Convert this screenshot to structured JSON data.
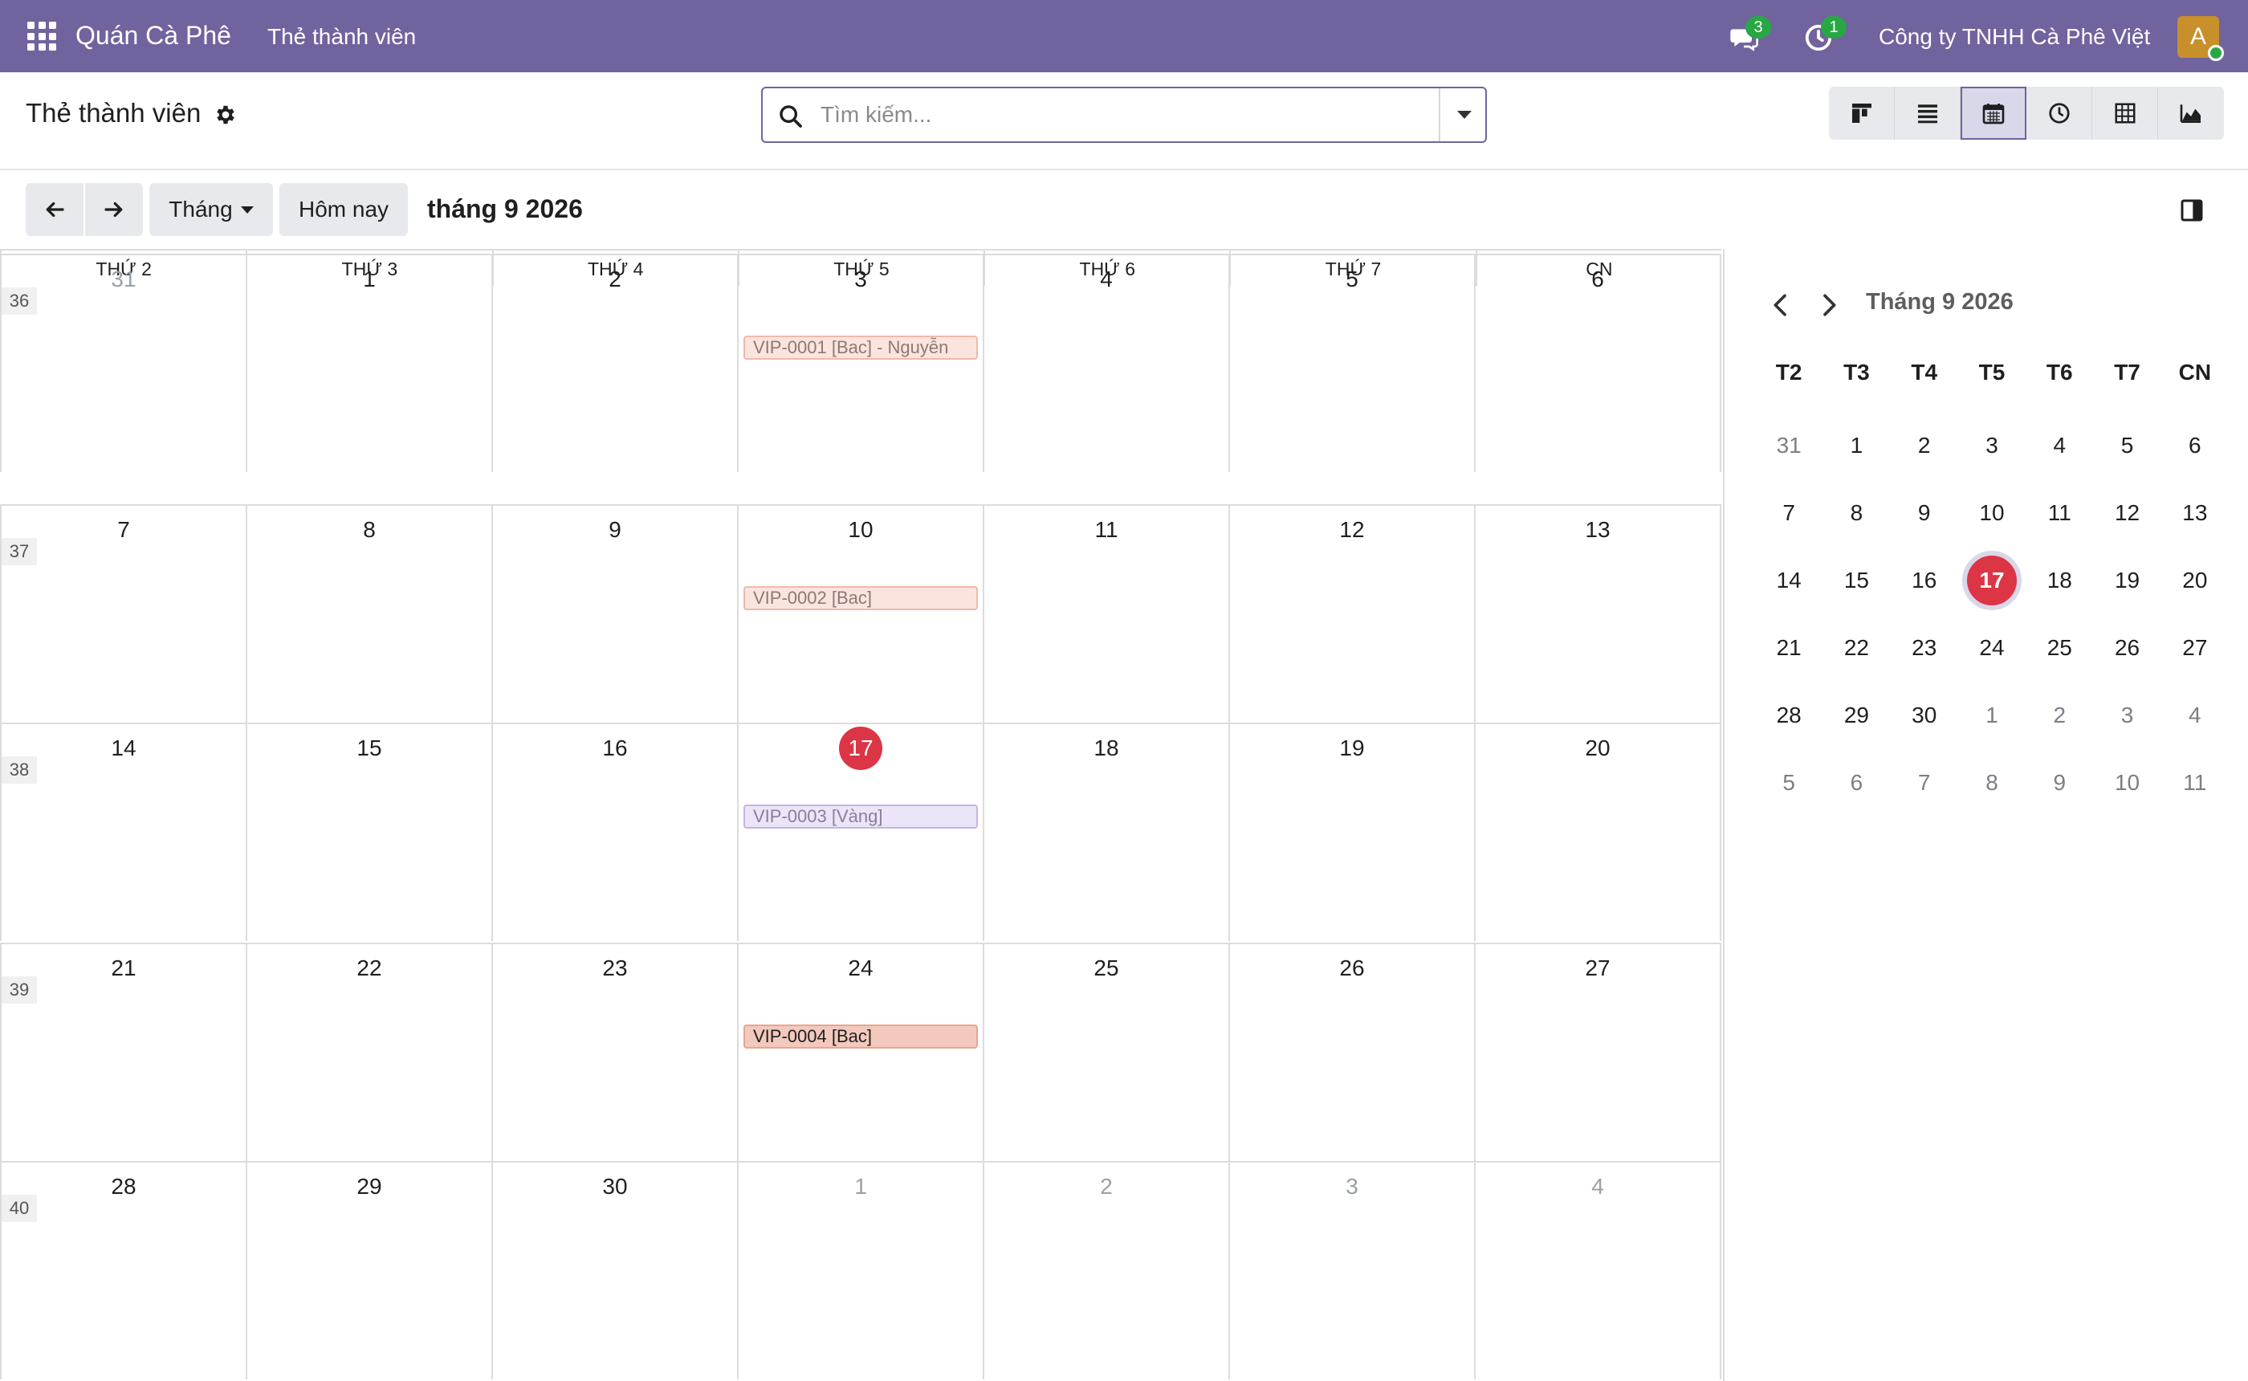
{
  "navbar": {
    "brand": "Quán Cà Phê",
    "menu_item": "Thẻ thành viên",
    "messages_count": "3",
    "activities_count": "1",
    "company": "Công ty TNHH Cà Phê Việt",
    "avatar_letter": "A"
  },
  "control_panel": {
    "title": "Thẻ thành viên",
    "search_placeholder": "Tìm kiếm...",
    "views": [
      "kanban",
      "list",
      "calendar",
      "activity",
      "pivot",
      "graph"
    ],
    "active_view": "calendar"
  },
  "toolbar": {
    "prev_icon": "arrow-left",
    "next_icon": "arrow-right",
    "scale_label": "Tháng",
    "today_label": "Hôm nay",
    "period_title": "tháng 9 2026"
  },
  "month_view": {
    "weekdays": [
      "THỨ 2",
      "THỨ 3",
      "THỨ 4",
      "THỨ 5",
      "THỨ 6",
      "THỨ 7",
      "CN"
    ],
    "weeks": [
      {
        "number": "36",
        "days": [
          "31",
          "1",
          "2",
          "3",
          "4",
          "5",
          "6"
        ]
      },
      {
        "number": "37",
        "days": [
          "7",
          "8",
          "9",
          "10",
          "11",
          "12",
          "13"
        ]
      },
      {
        "number": "38",
        "days": [
          "14",
          "15",
          "16",
          "17",
          "18",
          "19",
          "20"
        ]
      },
      {
        "number": "39",
        "days": [
          "21",
          "22",
          "23",
          "24",
          "25",
          "26",
          "27"
        ]
      },
      {
        "number": "40",
        "days": [
          "28",
          "29",
          "30",
          "1",
          "2",
          "3",
          "4"
        ]
      }
    ],
    "today": "17",
    "events": [
      {
        "title": "VIP-0001 [Bac] - Nguyễn",
        "bg": "#fbe4dd",
        "border": "#efb9a8",
        "color": "#8a7a76"
      },
      {
        "title": "VIP-0002 [Bac]",
        "bg": "#fbe4dd",
        "border": "#efb9a8",
        "color": "#8a7a76"
      },
      {
        "title": "VIP-0003 [Vàng]",
        "bg": "#ece4f7",
        "border": "#c7b3e6",
        "color": "#8a7f97"
      },
      {
        "title": "VIP-0004 [Bac]",
        "bg": "#f3c9bd",
        "border": "#e8a591",
        "color": "#1f1f1f"
      }
    ]
  },
  "mini_calendar": {
    "title": "Tháng 9 2026",
    "weekdays": [
      "T2",
      "T3",
      "T4",
      "T5",
      "T6",
      "T7",
      "CN"
    ],
    "weeks": [
      [
        "31",
        "1",
        "2",
        "3",
        "4",
        "5",
        "6"
      ],
      [
        "7",
        "8",
        "9",
        "10",
        "11",
        "12",
        "13"
      ],
      [
        "14",
        "15",
        "16",
        "17",
        "18",
        "19",
        "20"
      ],
      [
        "21",
        "22",
        "23",
        "24",
        "25",
        "26",
        "27"
      ],
      [
        "28",
        "29",
        "30",
        "1",
        "2",
        "3",
        "4"
      ],
      [
        "5",
        "6",
        "7",
        "8",
        "9",
        "10",
        "11"
      ]
    ],
    "today": "17"
  },
  "colors": {
    "navbar": "#71639e",
    "today_red": "#dc3545",
    "badge_green": "#28a745"
  }
}
